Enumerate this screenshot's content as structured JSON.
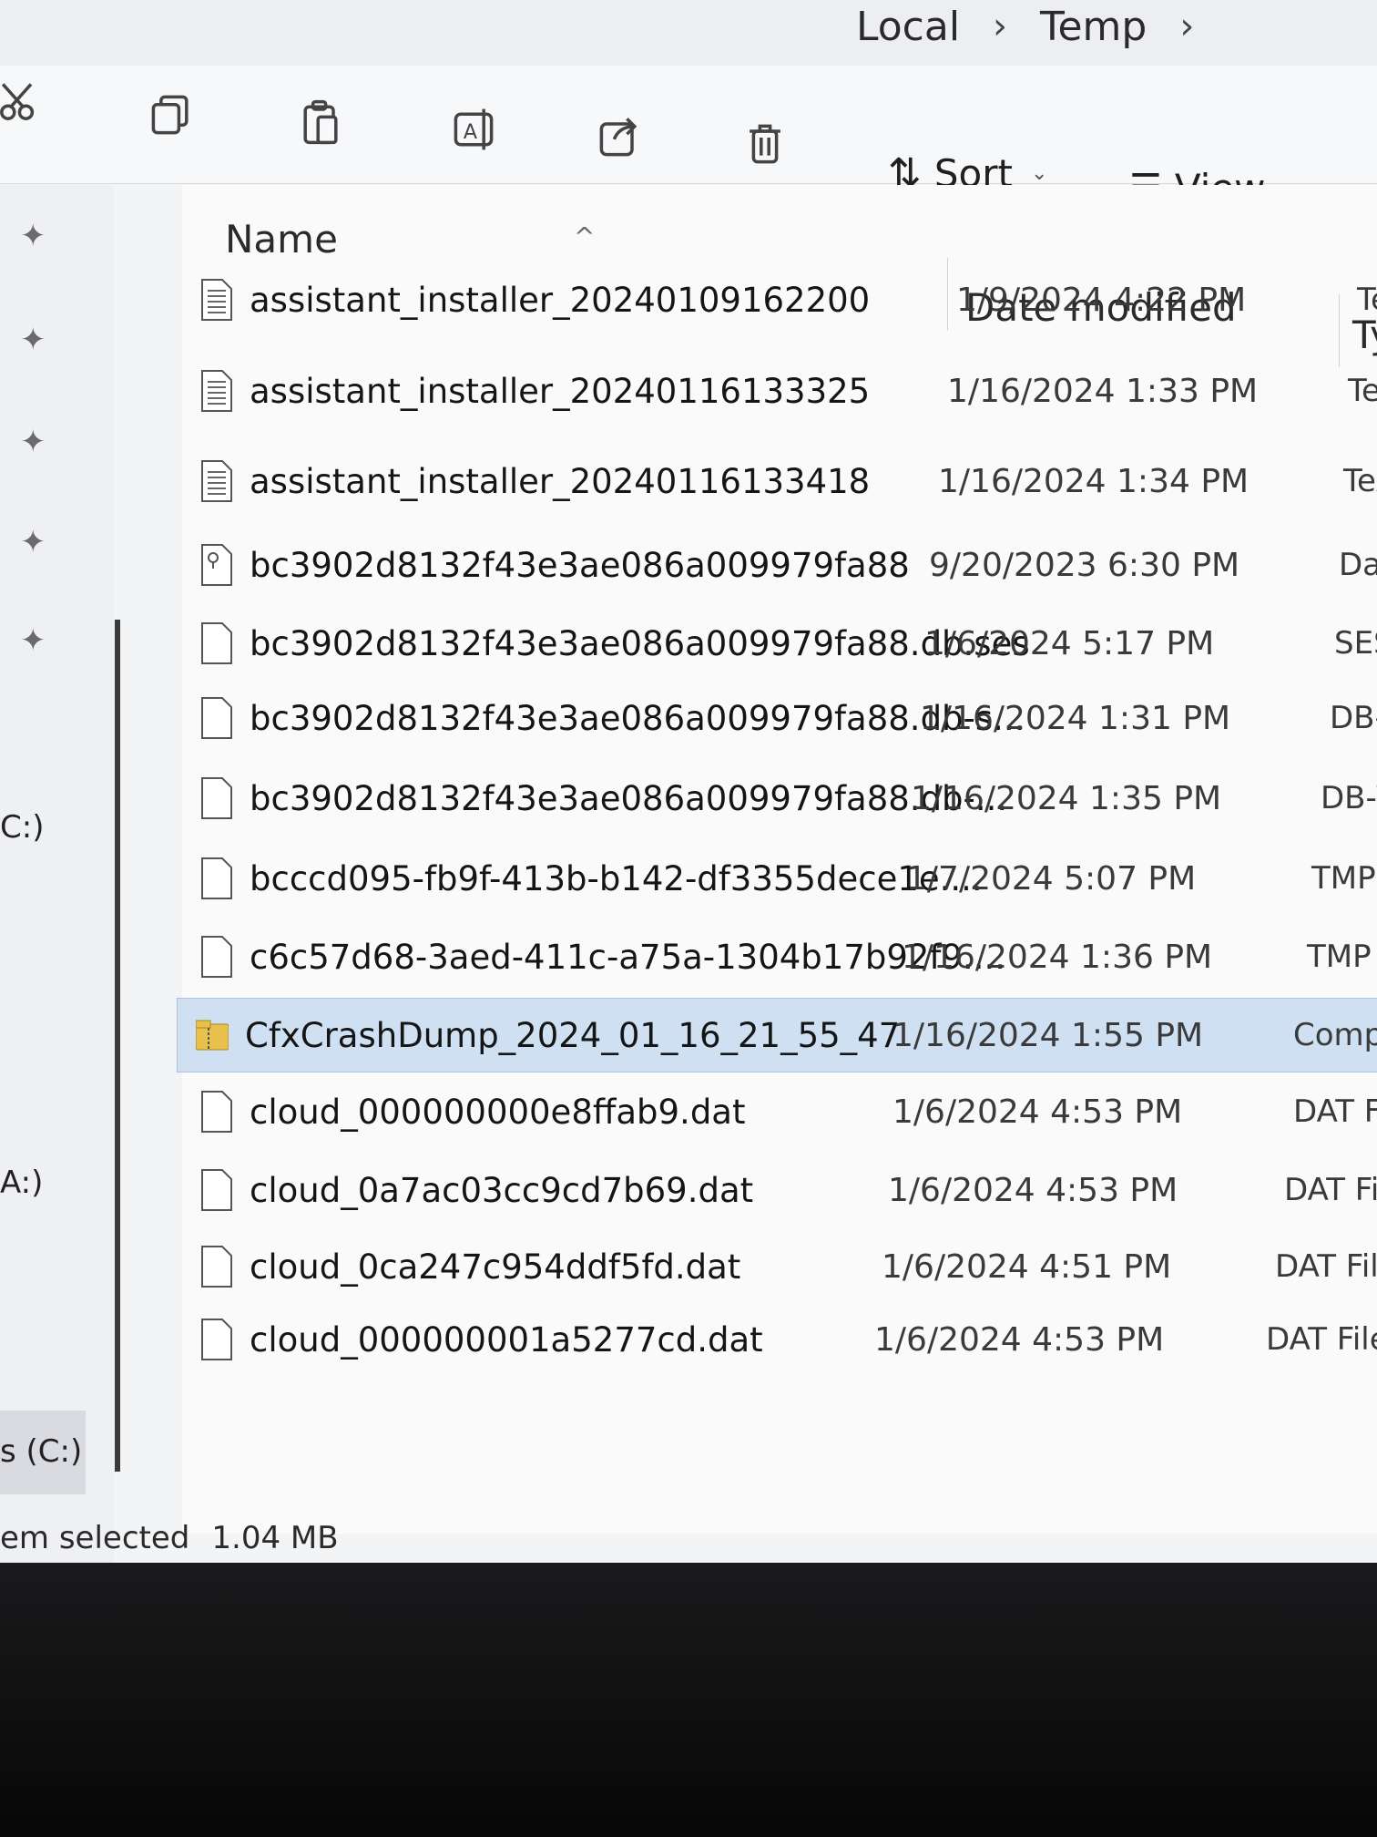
{
  "breadcrumb": {
    "items": [
      "Local",
      "Temp"
    ],
    "separator": "›"
  },
  "toolbar": {
    "sort_label": "Sort",
    "view_label": "View"
  },
  "nav": {
    "drives": [
      "C:)",
      "A:)",
      "s (C:)"
    ]
  },
  "columns": {
    "name": "Name",
    "date": "Date modified",
    "type": "Ty"
  },
  "files": [
    {
      "name": "assistant_installer_20240109162200",
      "date": "1/9/2024 4:22 PM",
      "type": "Tex",
      "icon": "text-file-icon"
    },
    {
      "name": "assistant_installer_20240116133325",
      "date": "1/16/2024 1:33 PM",
      "type": "Text",
      "icon": "text-file-icon"
    },
    {
      "name": "assistant_installer_20240116133418",
      "date": "1/16/2024 1:34 PM",
      "type": "Text",
      "icon": "text-file-icon"
    },
    {
      "name": "bc3902d8132f43e3ae086a009979fa88",
      "date": "9/20/2023 6:30 PM",
      "type": "Data",
      "icon": "data-file-icon"
    },
    {
      "name": "bc3902d8132f43e3ae086a009979fa88.db.ses",
      "date": "1/6/2024 5:17 PM",
      "type": "SES Fil",
      "icon": "blank-file-icon"
    },
    {
      "name": "bc3902d8132f43e3ae086a009979fa88.db-s...",
      "date": "1/16/2024 1:31 PM",
      "type": "DB-SHI",
      "icon": "blank-file-icon"
    },
    {
      "name": "bc3902d8132f43e3ae086a009979fa88.db-...",
      "date": "1/16/2024 1:35 PM",
      "type": "DB-WAL",
      "icon": "blank-file-icon"
    },
    {
      "name": "bcccd095-fb9f-413b-b142-df3355dece1e....",
      "date": "1/7/2024 5:07 PM",
      "type": "TMP File",
      "icon": "blank-file-icon"
    },
    {
      "name": "c6c57d68-3aed-411c-a75a-1304b17b92f9....",
      "date": "1/16/2024 1:36 PM",
      "type": "TMP File",
      "icon": "blank-file-icon"
    },
    {
      "name": "CfxCrashDump_2024_01_16_21_55_47",
      "date": "1/16/2024 1:55 PM",
      "type": "Compresse",
      "icon": "zip-folder-icon",
      "selected": true
    },
    {
      "name": "cloud_000000000e8ffab9.dat",
      "date": "1/6/2024 4:53 PM",
      "type": "DAT File",
      "icon": "blank-file-icon"
    },
    {
      "name": "cloud_0a7ac03cc9cd7b69.dat",
      "date": "1/6/2024 4:53 PM",
      "type": "DAT File",
      "icon": "blank-file-icon"
    },
    {
      "name": "cloud_0ca247c954ddf5fd.dat",
      "date": "1/6/2024 4:51 PM",
      "type": "DAT File",
      "icon": "blank-file-icon"
    },
    {
      "name": "cloud_000000001a5277cd.dat",
      "date": "1/6/2024 4:53 PM",
      "type": "DAT File",
      "icon": "blank-file-icon"
    }
  ],
  "status": {
    "selection": "em selected",
    "size": "1.04 MB"
  },
  "colors": {
    "selection_bg": "#cfe0f2",
    "zip_folder": "#e8c04c"
  }
}
